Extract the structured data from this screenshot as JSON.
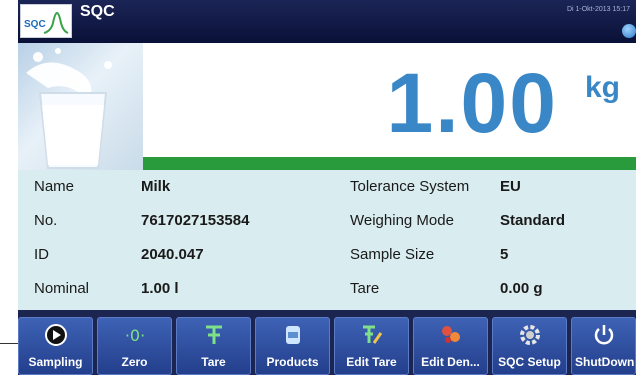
{
  "app": {
    "title": "SQC",
    "logo_text": "SQC",
    "datetime": "Di 1-Okt-2013 15:17"
  },
  "weight": {
    "value": "1.00",
    "unit": "kg",
    "progress": 1.0,
    "progress_color": "#2a9b3d",
    "value_color": "#3a87c7"
  },
  "info": {
    "rows": [
      {
        "label1": "Name",
        "value1": "Milk",
        "label2": "Tolerance System",
        "value2": "EU"
      },
      {
        "label1": "No.",
        "value1": "7617027153584",
        "label2": "Weighing Mode",
        "value2": "Standard"
      },
      {
        "label1": "ID",
        "value1": "2040.047",
        "label2": "Sample Size",
        "value2": "5"
      },
      {
        "label1": "Nominal",
        "value1": "1.00 l",
        "label2": "Tare",
        "value2": "0.00 g"
      }
    ]
  },
  "toolbar": {
    "buttons": [
      {
        "label": "Sampling",
        "icon": "play-circle-icon"
      },
      {
        "label": "Zero",
        "icon": "zero-icon"
      },
      {
        "label": "Tare",
        "icon": "tare-icon"
      },
      {
        "label": "Products",
        "icon": "products-icon"
      },
      {
        "label": "Edit Tare",
        "icon": "edit-tare-icon"
      },
      {
        "label": "Edit Den...",
        "icon": "edit-density-icon"
      },
      {
        "label": "SQC Setup",
        "icon": "setup-gear-icon"
      },
      {
        "label": "ShutDown",
        "icon": "power-icon"
      }
    ]
  }
}
